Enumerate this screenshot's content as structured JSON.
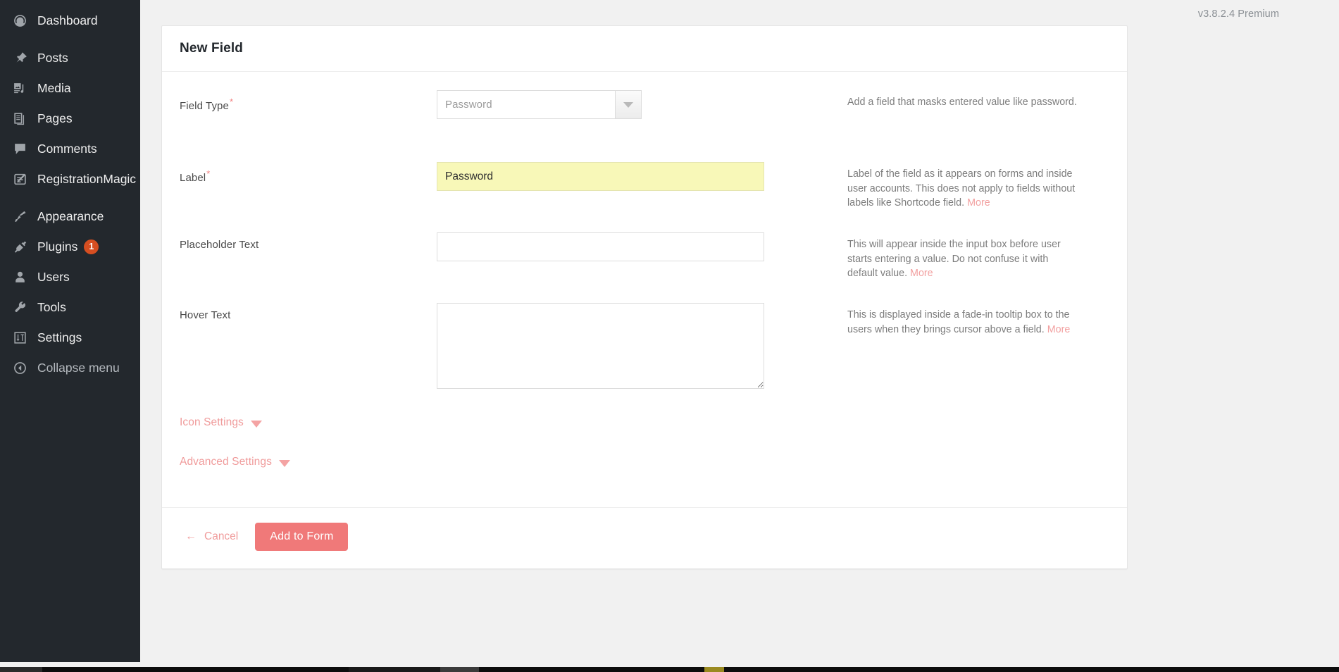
{
  "sidebar": {
    "items": [
      {
        "label": "Dashboard",
        "icon": "dashboard-icon",
        "sep_after": true
      },
      {
        "label": "Posts",
        "icon": "pin-icon",
        "sep_after": false
      },
      {
        "label": "Media",
        "icon": "media-icon",
        "sep_after": false
      },
      {
        "label": "Pages",
        "icon": "pages-icon",
        "sep_after": false
      },
      {
        "label": "Comments",
        "icon": "comment-icon",
        "sep_after": false
      },
      {
        "label": "RegistrationMagic",
        "icon": "registrationmagic-icon",
        "sep_after": true
      },
      {
        "label": "Appearance",
        "icon": "paintbrush-icon",
        "sep_after": false
      },
      {
        "label": "Plugins",
        "icon": "plug-icon",
        "badge": "1",
        "sep_after": false
      },
      {
        "label": "Users",
        "icon": "user-icon",
        "sep_after": false
      },
      {
        "label": "Tools",
        "icon": "wrench-icon",
        "sep_after": false
      },
      {
        "label": "Settings",
        "icon": "settings-sliders-icon",
        "sep_after": false
      },
      {
        "label": "Collapse menu",
        "icon": "collapse-arrow-icon",
        "sep_after": false
      }
    ]
  },
  "version_bar": {
    "text": "v3.8.2.4 Premium"
  },
  "card": {
    "title": "New Field",
    "rows": {
      "field_type": {
        "label": "Field Type",
        "required": true,
        "required_mark": "*",
        "selected_value": "Password",
        "help": "Add a field that masks entered value like password."
      },
      "label": {
        "label": "Label",
        "required": true,
        "required_mark": "*",
        "value": "Password",
        "placeholder": "",
        "help": "Label of the field as it appears on forms and inside user accounts. This does not apply to fields without labels like Shortcode field.",
        "more_label": "More"
      },
      "placeholder_text": {
        "label": "Placeholder Text",
        "required": false,
        "value": "",
        "placeholder": "",
        "help": "This will appear inside the input box before user starts entering a value. Do not confuse it with default value.",
        "more_label": "More"
      },
      "hover_text": {
        "label": "Hover Text",
        "required": false,
        "value": "",
        "placeholder": "",
        "help": "This is displayed inside a fade-in tooltip box to the users when they brings cursor above a field.",
        "more_label": "More"
      }
    },
    "toggles": [
      {
        "label": "Icon Settings",
        "icon": "chevron-down-icon",
        "expanded": false
      },
      {
        "label": "Advanced Settings",
        "icon": "chevron-down-icon",
        "expanded": false
      }
    ],
    "footer": {
      "cancel_arrow": "←",
      "cancel_label": "Cancel",
      "submit_label": "Add to Form"
    }
  },
  "colors": {
    "sidebar_bg": "#23282d",
    "accent_pink": "#f07979",
    "accent_pink_light": "#f09b9b",
    "badge_orange": "#d54e21",
    "autofill_yellow": "#f8f8b8",
    "page_bg": "#f1f1f1"
  }
}
